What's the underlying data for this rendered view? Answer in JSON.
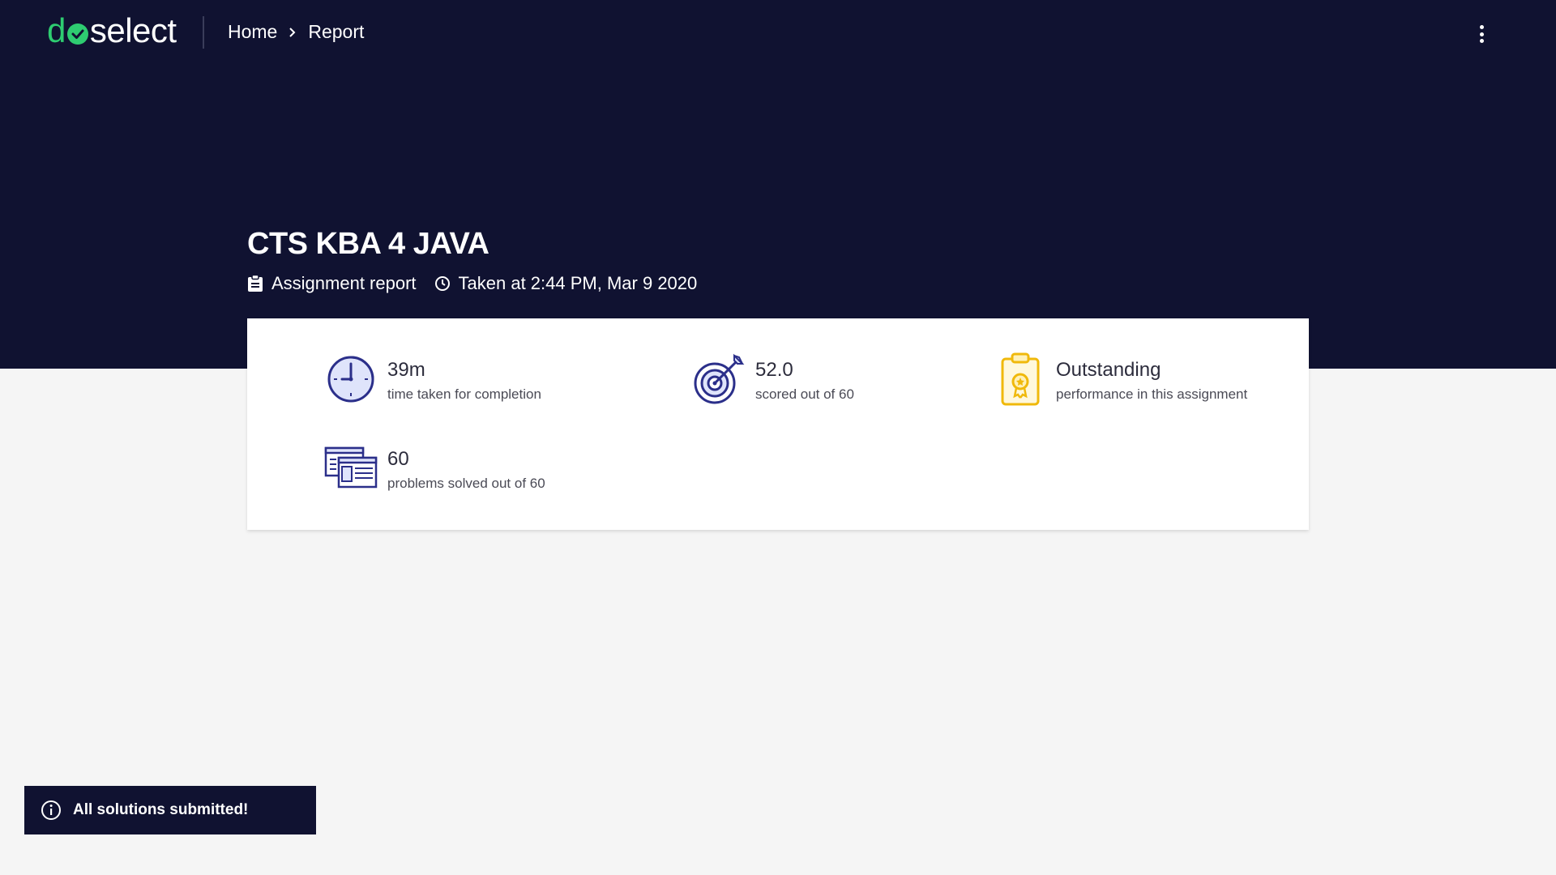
{
  "app": {
    "logo_prefix": "d",
    "logo_suffix": "select",
    "brand_color": "#2ecc71",
    "header_bg": "#101231"
  },
  "breadcrumb": {
    "home": "Home",
    "current": "Report"
  },
  "report": {
    "title": "CTS KBA 4 JAVA",
    "type_label": "Assignment report",
    "taken_at": "Taken at 2:44 PM, Mar 9 2020"
  },
  "stats": {
    "time": {
      "value": "39m",
      "label": "time taken for completion",
      "icon": "clock-icon"
    },
    "score": {
      "value": "52.0",
      "label": "scored out of 60",
      "icon": "target-icon"
    },
    "performance": {
      "value": "Outstanding",
      "label": "performance in this assignment",
      "icon": "certificate-icon"
    },
    "problems": {
      "value": "60",
      "label": "problems solved out of 60",
      "icon": "problems-icon"
    }
  },
  "toast": {
    "message": "All solutions submitted!",
    "icon": "info-icon"
  }
}
